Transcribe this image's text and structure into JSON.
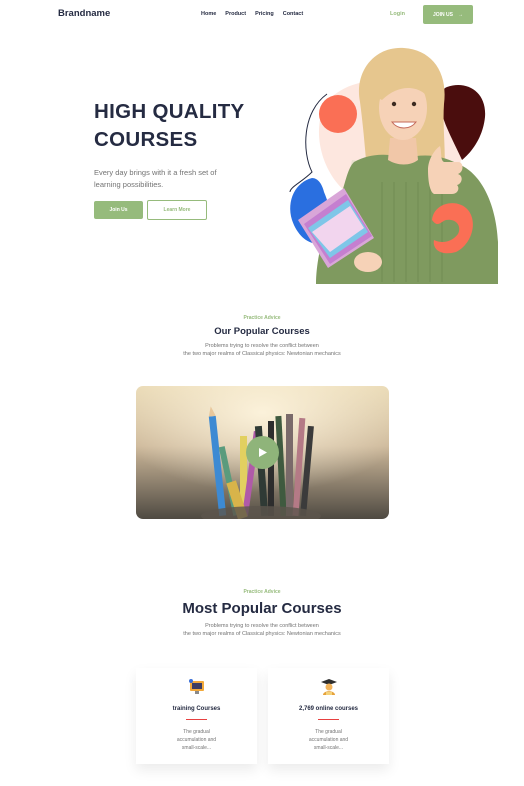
{
  "header": {
    "brand": "Brandname",
    "nav": [
      "Home",
      "Product",
      "Pricing",
      "Contact"
    ],
    "login_label": "Login",
    "join_label": "JOIN US",
    "join_arrow": "→"
  },
  "hero": {
    "title_line1": "HIGH QUALITY",
    "title_line2": "COURSES",
    "text_line1": "Every day brings with it a fresh set of",
    "text_line2": "learning possibilities.",
    "primary_button": "Join Us",
    "secondary_button": "Learn More"
  },
  "popular": {
    "eyebrow": "Practice Advice",
    "title": "Our Popular Courses",
    "desc_line1": "Problems trying to resolve the conflict between",
    "desc_line2": "the two major realms of Classical physics: Newtonian mechanics"
  },
  "most_popular": {
    "eyebrow": "Practice Advice",
    "title": "Most Popular Courses",
    "desc_line1": "Problems trying to resolve the conflict between",
    "desc_line2": "the two major realms of Classical physics: Newtonian mechanics",
    "cards": [
      {
        "icon": "training-board-icon",
        "title": "training Courses",
        "text_line1": "The gradual",
        "text_line2": "accumulation and",
        "text_line3": "small-scale..."
      },
      {
        "icon": "graduate-icon",
        "title": "2,769 online courses",
        "text_line1": "The gradual",
        "text_line2": "accumulation and",
        "text_line3": "small-scale..."
      }
    ]
  },
  "colors": {
    "primary": "#96bb7c",
    "heading": "#252b42",
    "muted": "#737373",
    "accent_red": "#e74040",
    "accent_coral": "#fa6f55"
  }
}
